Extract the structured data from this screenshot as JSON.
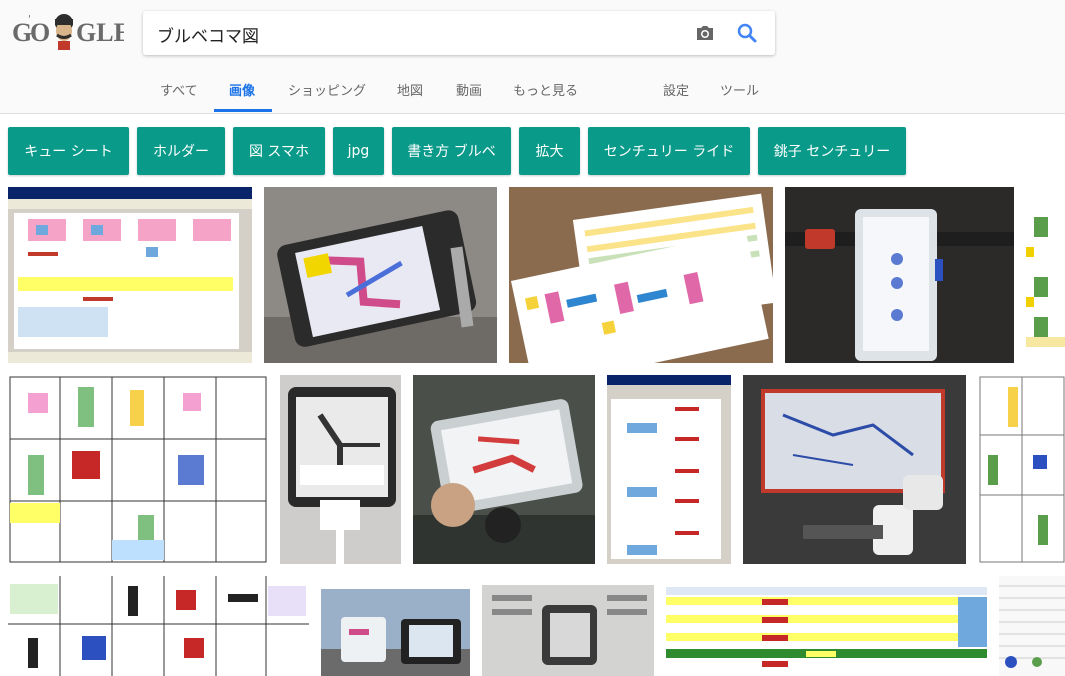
{
  "search": {
    "query": "ブルベコマ図"
  },
  "tabs": [
    {
      "label": "すべて"
    },
    {
      "label": "画像"
    },
    {
      "label": "ショッピング"
    },
    {
      "label": "地図"
    },
    {
      "label": "動画"
    },
    {
      "label": "もっと見る"
    },
    {
      "label": "設定"
    },
    {
      "label": "ツール"
    }
  ],
  "chips": [
    {
      "label": "キュー シート"
    },
    {
      "label": "ホルダー"
    },
    {
      "label": "図 スマホ"
    },
    {
      "label": "jpg"
    },
    {
      "label": "書き方 ブルベ"
    },
    {
      "label": "拡大"
    },
    {
      "label": "センチュリー ライド"
    },
    {
      "label": "銚子 センチュリー"
    }
  ],
  "colors": {
    "accent": "#1a73e8",
    "chip_bg": "#0a9a8a"
  }
}
